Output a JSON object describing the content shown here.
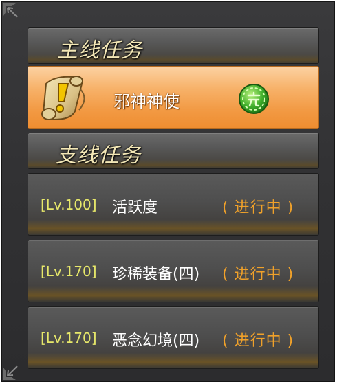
{
  "main_header": {
    "label": "主线任务"
  },
  "main_task": {
    "name": "邪神神使",
    "status_icon": "complete-seal-icon",
    "task_icon": "scroll-icon"
  },
  "side_header": {
    "label": "支线任务"
  },
  "side_tasks": [
    {
      "level": "[Lv.100]",
      "name": "活跃度",
      "status": "( 进行中 )"
    },
    {
      "level": "[Lv.170]",
      "name": "珍稀装备(四)",
      "status": "( 进行中 )"
    },
    {
      "level": "[Lv.170]",
      "name": "恶念幻境(四)",
      "status": "( 进行中 )"
    }
  ],
  "colors": {
    "panel_bg": "#333335",
    "selected_row": "#f29a44",
    "level_text": "#e7e86a",
    "status_text": "#f0a12a",
    "header_text": "#f3e7b6"
  }
}
